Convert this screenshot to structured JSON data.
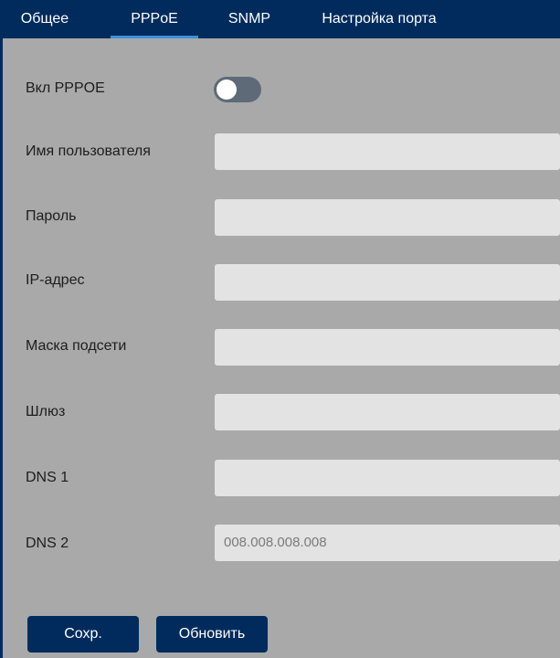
{
  "tabs": [
    {
      "label": "Общее",
      "active": false
    },
    {
      "label": "PPPoE",
      "active": true
    },
    {
      "label": "SNMP",
      "active": false
    },
    {
      "label": "Настройка порта",
      "active": false
    }
  ],
  "pppoe": {
    "enable_label": "Вкл PPPOE",
    "enabled": false,
    "fields": {
      "username": {
        "label": "Имя пользователя",
        "value": ""
      },
      "password": {
        "label": "Пароль",
        "value": ""
      },
      "ip": {
        "label": "IP-адрес",
        "value": ""
      },
      "mask": {
        "label": "Маска подсети",
        "value": ""
      },
      "gateway": {
        "label": "Шлюз",
        "value": ""
      },
      "dns1": {
        "label": "DNS 1",
        "value": ""
      },
      "dns2": {
        "label": "DNS 2",
        "value": "008.008.008.008"
      }
    }
  },
  "actions": {
    "save_label": "Сохр.",
    "refresh_label": "Обновить"
  },
  "colors": {
    "header_bg": "#002b5c",
    "active_tab_underline": "#3f8fd8",
    "panel_bg": "#a9a9a9",
    "field_bg": "#e3e3e3",
    "button_bg": "#002b5c"
  }
}
